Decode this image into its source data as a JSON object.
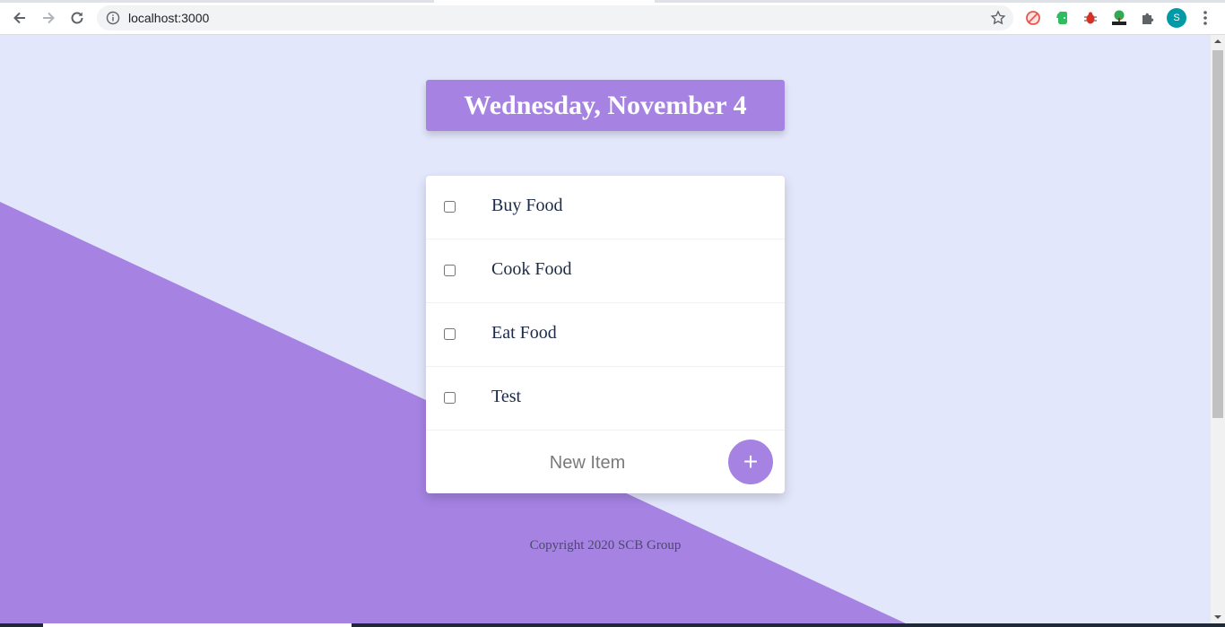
{
  "browser": {
    "url": "localhost:3000",
    "avatar_letter": "S",
    "extensions": [
      "no-tracking-icon",
      "evernote-icon",
      "bug-icon",
      "html-tree-icon",
      "puzzle-icon"
    ]
  },
  "header": {
    "date": "Wednesday, November 4"
  },
  "todo": {
    "items": [
      {
        "label": "Buy Food",
        "checked": false
      },
      {
        "label": "Cook Food",
        "checked": false
      },
      {
        "label": "Eat Food",
        "checked": false
      },
      {
        "label": "Test",
        "checked": false
      }
    ],
    "new_item_placeholder": "New Item",
    "add_button_label": "+"
  },
  "footer": {
    "text": "Copyright 2020 SCB Group"
  },
  "colors": {
    "accent": "#a683e3",
    "background": "#e3e7fb"
  }
}
